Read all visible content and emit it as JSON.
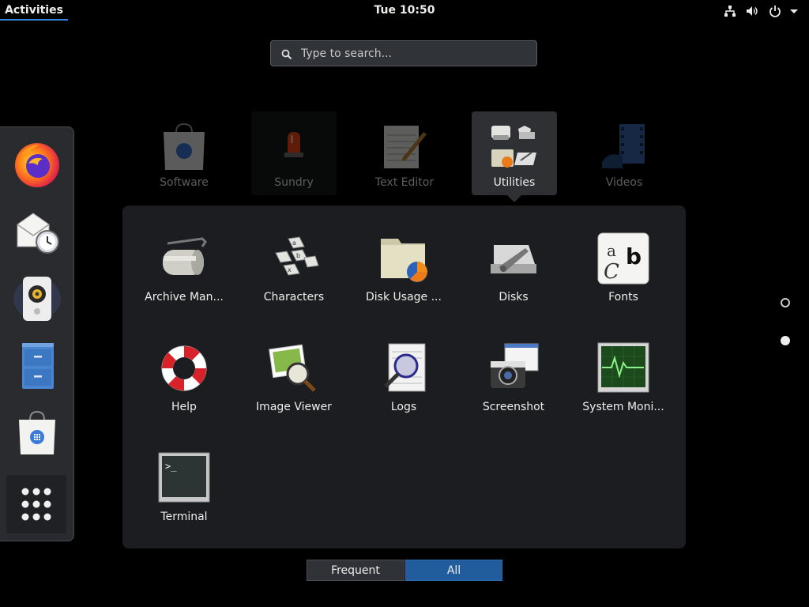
{
  "topbar": {
    "activities": "Activities",
    "clock": "Tue 10:50",
    "icons": [
      "network-icon",
      "volume-icon",
      "power-icon",
      "menu-arrow-icon"
    ],
    "accent": "#3584e4"
  },
  "search": {
    "placeholder": "Type to search..."
  },
  "dash": {
    "items": [
      {
        "name": "Firefox",
        "icon": "firefox-icon"
      },
      {
        "name": "Evolution",
        "icon": "mail-clock-icon"
      },
      {
        "name": "Rhythmbox",
        "icon": "speaker-icon"
      },
      {
        "name": "Files",
        "icon": "file-cabinet-icon"
      },
      {
        "name": "Software",
        "icon": "shopping-bag-icon"
      }
    ],
    "show_apps_icon": "grid-dots-icon"
  },
  "folders": [
    {
      "label": "Software",
      "icon": "shopping-bag-icon"
    },
    {
      "label": "Sundry",
      "icon": "alarm-light-icon"
    },
    {
      "label": "Text Editor",
      "icon": "notepad-pencil-icon"
    },
    {
      "label": "Utilities",
      "icon": "utilities-folder-icon",
      "selected": true
    },
    {
      "label": "Videos",
      "icon": "film-icon"
    }
  ],
  "utilities": {
    "apps": [
      {
        "label": "Archive Man...",
        "icon": "roller-icon"
      },
      {
        "label": "Characters",
        "icon": "keys-icon"
      },
      {
        "label": "Disk Usage ...",
        "icon": "folder-pie-icon"
      },
      {
        "label": "Disks",
        "icon": "disk-icon"
      },
      {
        "label": "Fonts",
        "icon": "fonts-icon"
      },
      {
        "label": "Help",
        "icon": "lifebuoy-icon"
      },
      {
        "label": "Image Viewer",
        "icon": "image-magnifier-icon"
      },
      {
        "label": "Logs",
        "icon": "logs-magnifier-icon"
      },
      {
        "label": "Screenshot",
        "icon": "camera-windows-icon"
      },
      {
        "label": "System Moni...",
        "icon": "monitor-pulse-icon"
      },
      {
        "label": "Terminal",
        "icon": "terminal-icon"
      }
    ],
    "fonts_glyphs": {
      "a": "a",
      "b": "b",
      "c": "C"
    },
    "terminal_prompt": ">_"
  },
  "pages": {
    "count": 2,
    "current": 2
  },
  "tabs": {
    "frequent": "Frequent",
    "all": "All",
    "active": "All"
  },
  "colors": {
    "selected_tab": "#215d9c",
    "popup_bg": "#1c1d20",
    "dash_bg": "#2a2b2e"
  }
}
